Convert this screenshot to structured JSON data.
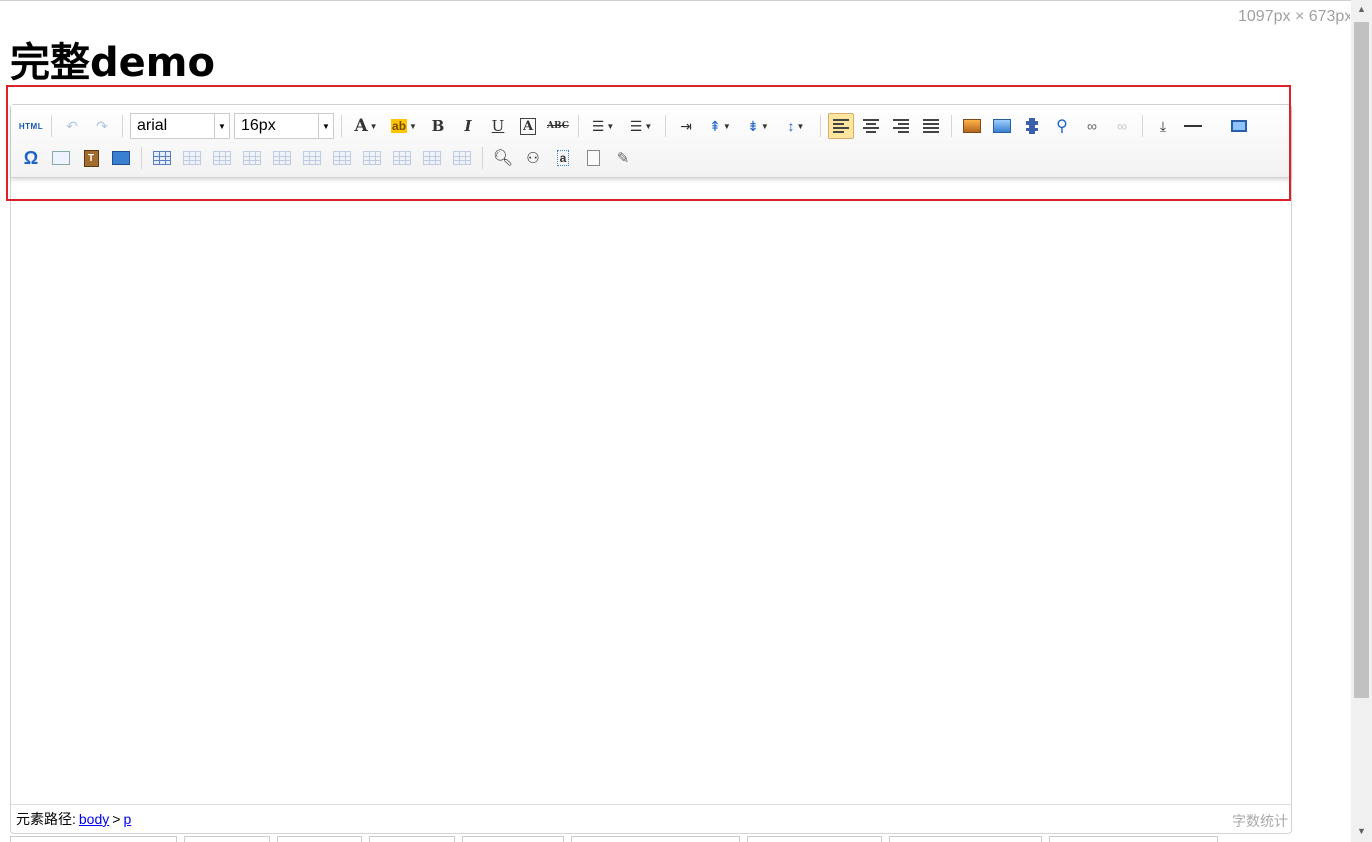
{
  "page": {
    "title": "完整demo",
    "size_readout": "1097px × 673px"
  },
  "toolbar": {
    "font_family": "arial",
    "font_size": "16px",
    "row1": [
      {
        "name": "html-source-icon",
        "label": "HTML"
      },
      {
        "name": "undo-icon"
      },
      {
        "name": "redo-icon"
      },
      {
        "name": "font-color-icon",
        "label": "A"
      },
      {
        "name": "highlight-color-icon",
        "label": "ab"
      },
      {
        "name": "bold-icon",
        "label": "B"
      },
      {
        "name": "italic-icon",
        "label": "I"
      },
      {
        "name": "underline-icon",
        "label": "U"
      },
      {
        "name": "font-border-icon",
        "label": "A"
      },
      {
        "name": "strikethrough-icon",
        "label": "ABC"
      }
    ],
    "special_char_glyph": "Ω"
  },
  "statusbar": {
    "path_label": "元素路径:",
    "path_items": [
      "body",
      "p"
    ],
    "path_separator": ">",
    "word_count": "字数统计"
  },
  "colors": {
    "highlight_border": "#d9222a",
    "active_button": "#ffe69f",
    "link": "#0000ee"
  }
}
